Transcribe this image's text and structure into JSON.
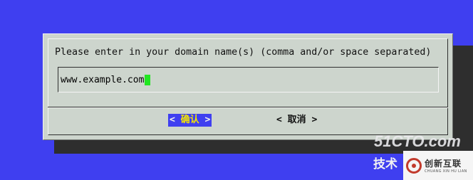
{
  "dialog": {
    "prompt": "Please enter in your domain name(s) (comma and/or space separated)",
    "input_value": "www.example.com",
    "ok_label": "确认",
    "cancel_label": "取消",
    "arrow_left": "<",
    "arrow_right": ">"
  },
  "watermark": {
    "site": "51CTO.com",
    "sub": "技术",
    "logo_cn": "创新互联",
    "logo_en": "CHUANG XIN HU LIAN"
  },
  "colors": {
    "background": "#3f3ff0",
    "dialog": "#cdd5cd",
    "cursor": "#22e622",
    "ok_label": "#f5e600"
  }
}
